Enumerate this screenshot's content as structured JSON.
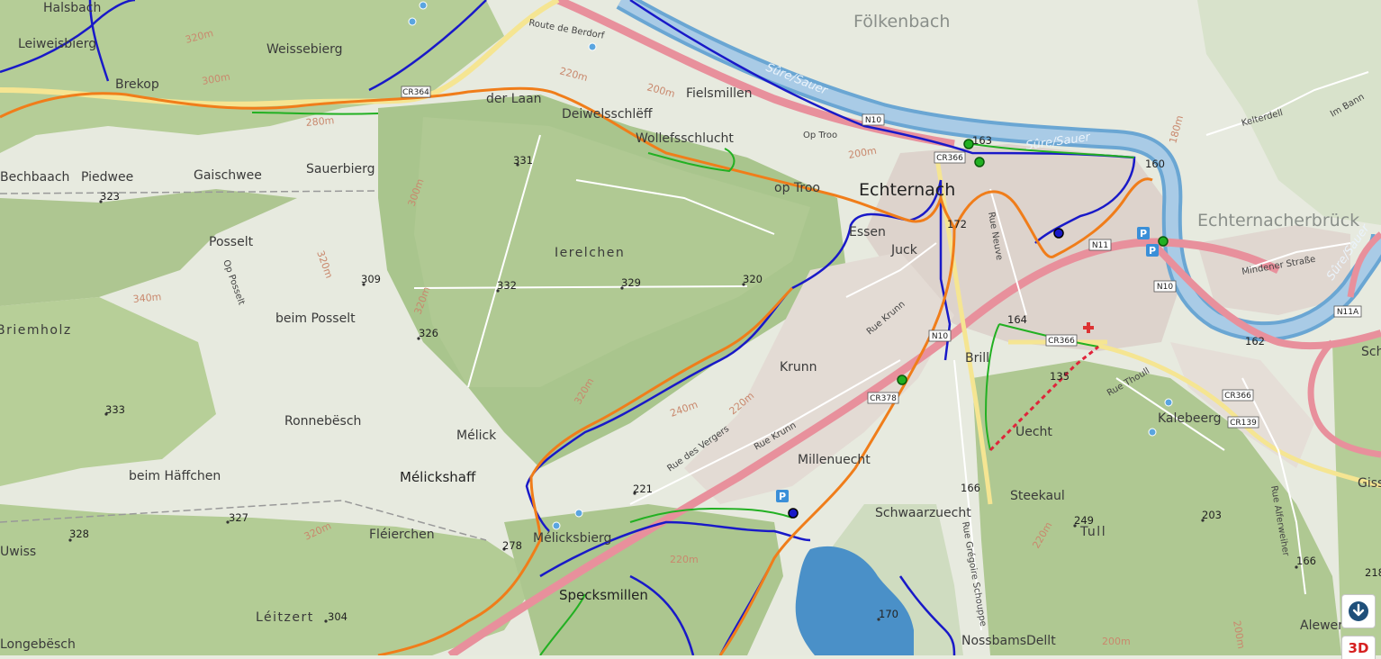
{
  "map": {
    "river_label": "Sûre/Sauer",
    "localities": [
      {
        "name": "Fölkenbach",
        "kind": "faded"
      },
      {
        "name": "Echternach",
        "kind": "city"
      },
      {
        "name": "Echternacherbrück",
        "kind": "faded"
      },
      {
        "name": "Mélickshaff",
        "kind": "town"
      },
      {
        "name": "Ierelchen",
        "kind": "area"
      },
      {
        "name": "Tull",
        "kind": "area"
      },
      {
        "name": "Léitzert",
        "kind": "area"
      },
      {
        "name": "Briemholz",
        "kind": "area"
      },
      {
        "name": "Weissebierg",
        "kind": "place"
      },
      {
        "name": "Gaischwee",
        "kind": "place"
      },
      {
        "name": "Piedwee",
        "kind": "place"
      },
      {
        "name": "Sauerbierg",
        "kind": "place"
      },
      {
        "name": "Posselt",
        "kind": "place"
      },
      {
        "name": "beim Posselt",
        "kind": "place"
      },
      {
        "name": "Ronnebësch",
        "kind": "place"
      },
      {
        "name": "Mélick",
        "kind": "place"
      },
      {
        "name": "Mélicksbierg",
        "kind": "place"
      },
      {
        "name": "Fléierchen",
        "kind": "place"
      },
      {
        "name": "beim Häffchen",
        "kind": "place"
      },
      {
        "name": "Specksmillen",
        "kind": "town"
      },
      {
        "name": "Millenuecht",
        "kind": "place"
      },
      {
        "name": "Schwaarzuecht",
        "kind": "place"
      },
      {
        "name": "Krunn",
        "kind": "place"
      },
      {
        "name": "Juck",
        "kind": "place"
      },
      {
        "name": "Brill",
        "kind": "place"
      },
      {
        "name": "Uecht",
        "kind": "place"
      },
      {
        "name": "Kalebeerg",
        "kind": "place"
      },
      {
        "name": "Steekaul",
        "kind": "place"
      },
      {
        "name": "NossbamsDellt",
        "kind": "place"
      },
      {
        "name": "Alewer",
        "kind": "place"
      },
      {
        "name": "Fielsmillen",
        "kind": "place"
      },
      {
        "name": "der Laan",
        "kind": "place"
      },
      {
        "name": "Deiwelsschlëff",
        "kind": "place"
      },
      {
        "name": "Wollefsschlucht",
        "kind": "place"
      },
      {
        "name": "op Troo",
        "kind": "place"
      },
      {
        "name": "Op Troo",
        "kind": "street"
      },
      {
        "name": "Essen",
        "kind": "place"
      },
      {
        "name": "Halsbach",
        "kind": "place"
      },
      {
        "name": "Leiweisbierg",
        "kind": "place"
      },
      {
        "name": "Brekop",
        "kind": "place"
      },
      {
        "name": "Bechbaach",
        "kind": "place"
      },
      {
        "name": "Gissen",
        "kind": "place"
      },
      {
        "name": "Schou",
        "kind": "place"
      },
      {
        "name": "Longebësch",
        "kind": "place"
      },
      {
        "name": "Uwiss",
        "kind": "place"
      }
    ],
    "peaks": [
      "331",
      "323",
      "309",
      "332",
      "329",
      "320",
      "326",
      "333",
      "327",
      "328",
      "278",
      "221",
      "304",
      "164",
      "166",
      "172",
      "160",
      "162",
      "163",
      "249",
      "203",
      "166",
      "170",
      "135",
      "218"
    ],
    "contours": [
      "320m",
      "300m",
      "280m",
      "220m",
      "200m",
      "300m",
      "320m",
      "340m",
      "320m",
      "320m",
      "320m",
      "240m",
      "220m",
      "200m",
      "180m",
      "220m",
      "200m",
      "220m",
      "200m"
    ],
    "road_shields": [
      "CR364",
      "N10",
      "CR366",
      "N11",
      "N10",
      "CR378",
      "CR366",
      "CR139",
      "N11A",
      "N10",
      "CR366"
    ],
    "streets": [
      "Route de Berdorf",
      "Rue Neuve",
      "Rue Krunn",
      "Rue Krunn",
      "Rue des Vergers",
      "Rue Thoull",
      "Rue Grégoire Schouppe",
      "Op Posselt",
      "Rue Alferweiher",
      "Mindener Straße",
      "Kelterdell",
      "Im Bann"
    ],
    "parking": [
      "P",
      "P",
      "P"
    ]
  },
  "controls": {
    "download_icon": "download-circle-icon",
    "three_d_label": "3D"
  },
  "colors": {
    "water": "#4a90c8",
    "river": "#a9cbe6",
    "forest": "#a8c48a",
    "route_orange": "#f07d1a",
    "route_red": "#e0243a",
    "route_blue": "#1919c8",
    "route_green": "#22b022",
    "main_road": "#e8909c"
  }
}
